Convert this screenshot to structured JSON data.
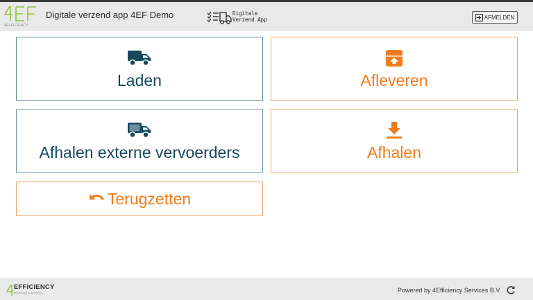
{
  "header": {
    "logo_text": "4EF",
    "logo_subtext": "4EFFICIENCY",
    "app_title": "Digitale verzend app 4EF Demo",
    "center_logo_line1": "Digitale",
    "center_logo_line2": "Verzend App",
    "logout_label": "AFMELDEN"
  },
  "tiles": {
    "laden": {
      "label": "Laden",
      "icon": "truck-icon"
    },
    "afleveren": {
      "label": "Afleveren",
      "icon": "box-up-icon"
    },
    "afhalen_extern": {
      "label": "Afhalen externe vervoerders",
      "icon": "truck-outline-icon"
    },
    "afhalen": {
      "label": "Afhalen",
      "icon": "download-icon"
    },
    "terugzetten": {
      "label": "Terugzetten",
      "icon": "undo-icon"
    }
  },
  "footer": {
    "logo_text": "EFFICIENCY",
    "logo_subtext": "SERVICING IN CONTROL",
    "powered_by": "Powered by 4Efficiency Services B.V."
  },
  "colors": {
    "blue_text": "#16495e",
    "orange": "#f07c1b",
    "green_logo": "#8cc63f"
  }
}
